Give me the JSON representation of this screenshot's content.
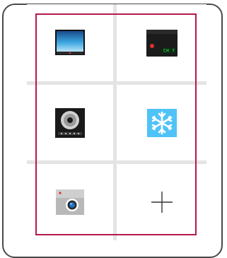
{
  "tiles": [
    {
      "label": "",
      "icon": "tv-screen-icon"
    },
    {
      "label": "CH 7",
      "icon": "set-top-box-icon"
    },
    {
      "label": "",
      "icon": "speaker-icon"
    },
    {
      "label": "",
      "icon": "snowflake-icon"
    },
    {
      "label": "",
      "icon": "camera-icon"
    },
    {
      "label": "",
      "icon": "add-icon"
    }
  ],
  "colors": {
    "selection": "#b5184e",
    "grid_gap": "#e4e4e4",
    "frame": "#4a4a4a",
    "snowflake_bg": "#4fc3f7"
  }
}
